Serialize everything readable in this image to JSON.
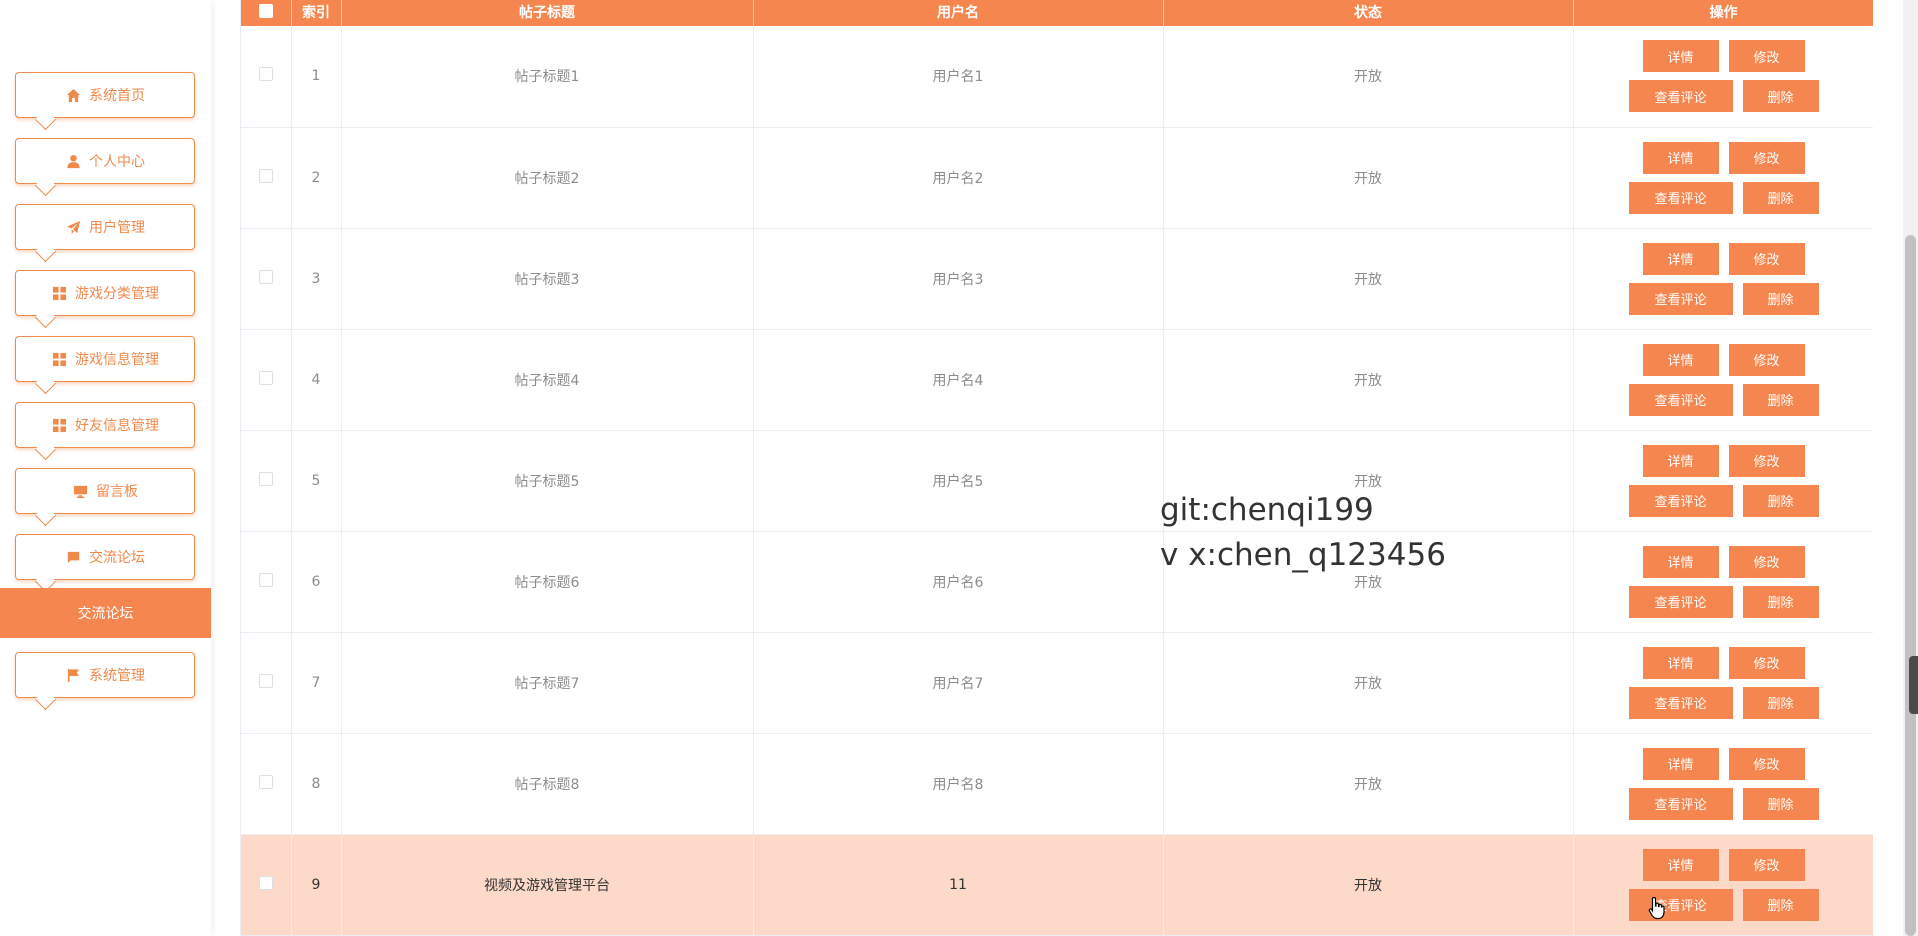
{
  "sidebar": {
    "items": [
      {
        "label": "系统首页",
        "icon": "home-icon"
      },
      {
        "label": "个人中心",
        "icon": "user-icon"
      },
      {
        "label": "用户管理",
        "icon": "paper-plane-icon"
      },
      {
        "label": "游戏分类管理",
        "icon": "grid-icon"
      },
      {
        "label": "游戏信息管理",
        "icon": "grid-icon"
      },
      {
        "label": "好友信息管理",
        "icon": "grid-icon"
      },
      {
        "label": "留言板",
        "icon": "monitor-icon"
      },
      {
        "label": "交流论坛",
        "icon": "chat-icon"
      },
      {
        "label": "系统管理",
        "icon": "flag-icon"
      }
    ],
    "active_sub": "交流论坛"
  },
  "table": {
    "headers": [
      "",
      "索引",
      "帖子标题",
      "用户名",
      "状态",
      "操作"
    ],
    "actions": {
      "detail": "详情",
      "edit": "修改",
      "comment": "查看评论",
      "delete": "删除"
    },
    "rows": [
      {
        "index": "1",
        "title": "帖子标题1",
        "username": "用户名1",
        "status": "开放"
      },
      {
        "index": "2",
        "title": "帖子标题2",
        "username": "用户名2",
        "status": "开放"
      },
      {
        "index": "3",
        "title": "帖子标题3",
        "username": "用户名3",
        "status": "开放"
      },
      {
        "index": "4",
        "title": "帖子标题4",
        "username": "用户名4",
        "status": "开放"
      },
      {
        "index": "5",
        "title": "帖子标题5",
        "username": "用户名5",
        "status": "开放"
      },
      {
        "index": "6",
        "title": "帖子标题6",
        "username": "用户名6",
        "status": "开放"
      },
      {
        "index": "7",
        "title": "帖子标题7",
        "username": "用户名7",
        "status": "开放"
      },
      {
        "index": "8",
        "title": "帖子标题8",
        "username": "用户名8",
        "status": "开放"
      },
      {
        "index": "9",
        "title": "视频及游戏管理平台",
        "username": "11",
        "status": "开放",
        "selected": true
      }
    ]
  },
  "watermark": {
    "line1": "git:chenqi199",
    "line2": "v x:chen_q123456"
  },
  "colors": {
    "accent": "#f6864f",
    "selected_row": "#fcd9c8"
  }
}
